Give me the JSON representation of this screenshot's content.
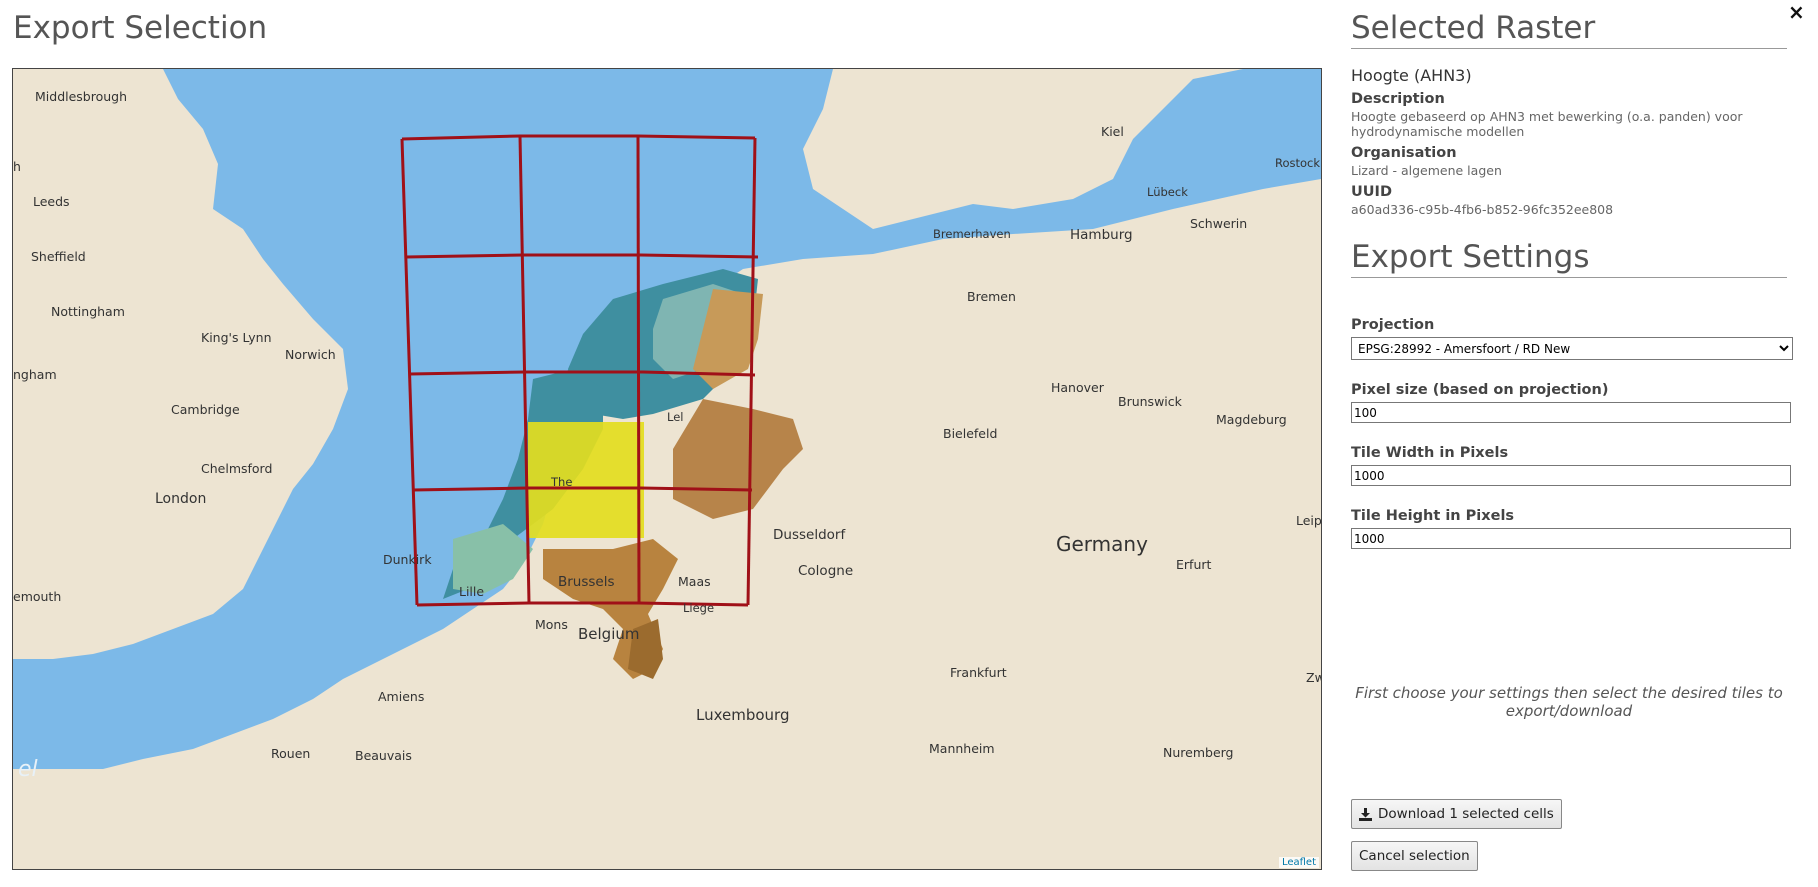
{
  "left": {
    "title": "Export Selection"
  },
  "map": {
    "attribution": "Leaflet",
    "labels": {
      "middlesbrough": "Middlesbrough",
      "leeds": "Leeds",
      "sheffield": "Sheffield",
      "nottingham": "Nottingham",
      "kings_lynn": "King's Lynn",
      "norwich": "Norwich",
      "ngham": "ngham",
      "cambridge": "Cambridge",
      "chelmsford": "Chelmsford",
      "london": "London",
      "emouth": "emouth",
      "dunkirk": "Dunkirk",
      "lille": "Lille",
      "mons": "Mons",
      "amiens": "Amiens",
      "rouen": "Rouen",
      "beauvais": "Beauvais",
      "brussels": "Brussels",
      "maas": "Maas",
      "liege": "Liege",
      "belgium": "Belgium",
      "luxembourg": "Luxembourg",
      "dusseldorf": "Dusseldorf",
      "cologne": "Cologne",
      "germany": "Germany",
      "erfurt": "Erfurt",
      "frankfurt": "Frankfurt",
      "mannheim": "Mannheim",
      "nuremberg": "Nuremberg",
      "bielefeld": "Bielefeld",
      "hanover": "Hanover",
      "brunswick": "Brunswick",
      "magdeburg": "Magdeburg",
      "bremen": "Bremen",
      "bremerhaven": "Bremerhaven",
      "hamburg": "Hamburg",
      "schwerin": "Schwerin",
      "lubeck": "Lübeck",
      "kiel": "Kiel",
      "rostock": "Rostock",
      "leip": "Leip",
      "zw": "Zw",
      "the": "The",
      "lel": "Lel",
      "h": "h",
      "el": "el"
    }
  },
  "close_label": "×",
  "raster": {
    "heading": "Selected Raster",
    "name": "Hoogte (AHN3)",
    "description_label": "Description",
    "description": "Hoogte gebaseerd op AHN3 met bewerking (o.a. panden) voor hydrodynamische modellen",
    "organisation_label": "Organisation",
    "organisation": "Lizard - algemene lagen",
    "uuid_label": "UUID",
    "uuid": "a60ad336-c95b-4fb6-b852-96fc352ee808"
  },
  "settings": {
    "heading": "Export Settings",
    "projection_label": "Projection",
    "projection_value": "EPSG:28992 - Amersfoort / RD New",
    "pixel_size_label": "Pixel size (based on projection)",
    "pixel_size_value": "100",
    "tile_width_label": "Tile Width in Pixels",
    "tile_width_value": "1000",
    "tile_height_label": "Tile Height in Pixels",
    "tile_height_value": "1000"
  },
  "hint": "First choose your settings then select the desired tiles to export/download",
  "buttons": {
    "download_label": "Download 1 selected cells",
    "download_icon": "download-icon",
    "cancel_label": "Cancel selection"
  },
  "colors": {
    "sea": "#7cb9e8",
    "land": "#ede4d2",
    "grid": "#a01018",
    "selected_cell": "#e3dd1e"
  }
}
